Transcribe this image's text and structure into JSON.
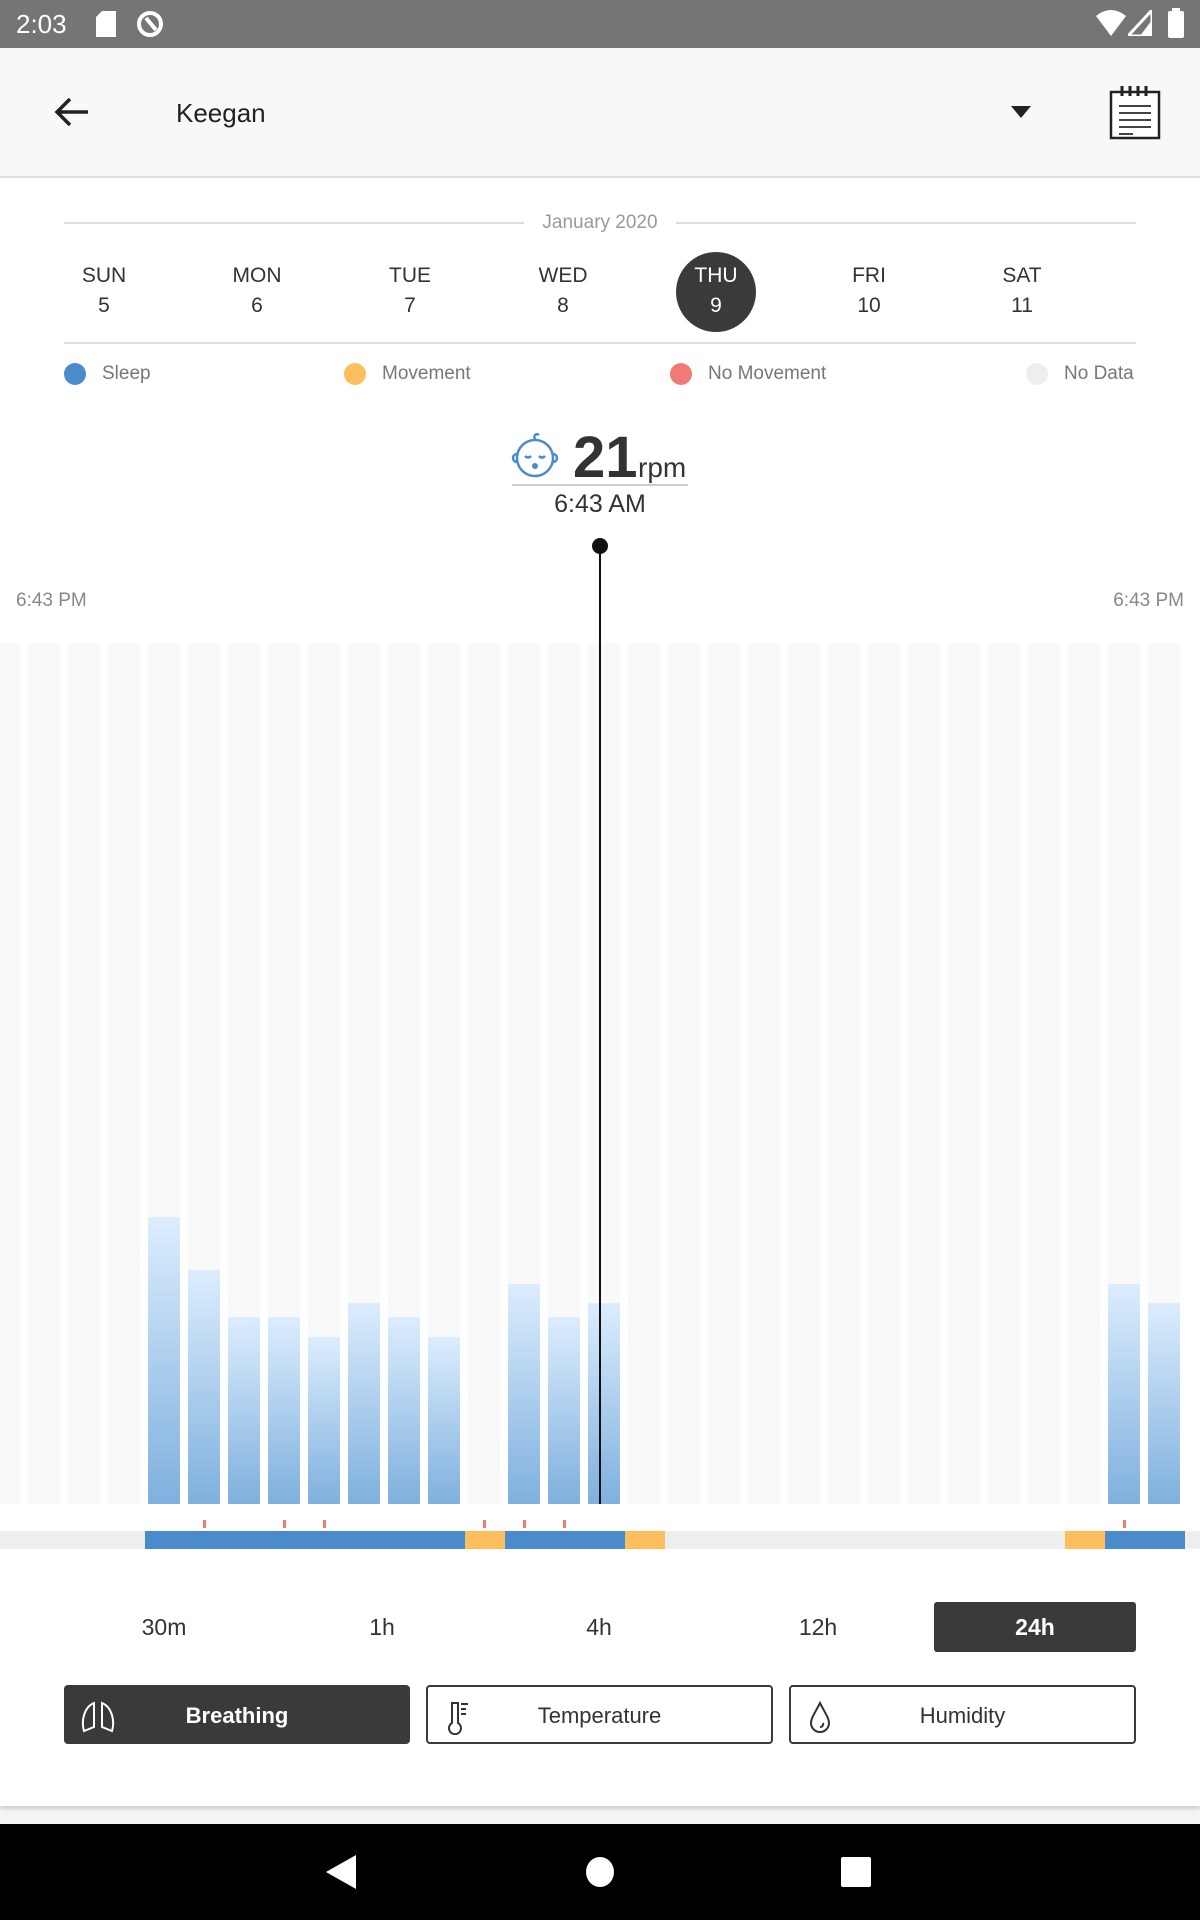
{
  "status_bar": {
    "time": "2:03",
    "icons": [
      "sd-card-icon",
      "sync-icon",
      "wifi-icon",
      "signal-icon",
      "battery-icon"
    ]
  },
  "header": {
    "title": "Keegan",
    "back_icon": "arrow-left-icon",
    "dropdown_icon": "caret-down-icon",
    "notes_icon": "notepad-icon"
  },
  "calendar": {
    "month": "January 2020",
    "selected": 4,
    "days": [
      {
        "name": "SUN",
        "num": "5"
      },
      {
        "name": "MON",
        "num": "6"
      },
      {
        "name": "TUE",
        "num": "7"
      },
      {
        "name": "WED",
        "num": "8"
      },
      {
        "name": "THU",
        "num": "9"
      },
      {
        "name": "FRI",
        "num": "10"
      },
      {
        "name": "SAT",
        "num": "11"
      }
    ]
  },
  "legend": [
    {
      "label": "Sleep",
      "color": "#4a8ccb"
    },
    {
      "label": "Movement",
      "color": "#fdbf5e"
    },
    {
      "label": "No Movement",
      "color": "#f07b74"
    },
    {
      "label": "No Data",
      "color": "#eeeeee"
    }
  ],
  "reading": {
    "value": "21",
    "unit": "rpm",
    "time": "6:43 AM",
    "icon": "sleeping-baby-icon"
  },
  "chart_data": {
    "type": "bar",
    "x_start_label": "6:43 PM",
    "x_end_label": "6:43 PM",
    "ylim": [
      0,
      90
    ],
    "values": [
      null,
      null,
      null,
      null,
      30,
      24.5,
      19.5,
      19.5,
      17.5,
      21,
      19.5,
      17.5,
      null,
      23,
      19.5,
      21,
      null,
      null,
      null,
      null,
      null,
      null,
      null,
      null,
      null,
      null,
      null,
      null,
      23,
      21
    ],
    "selected_index": 15,
    "state_strip": [
      "none",
      "none",
      "none",
      "none",
      "sleep",
      "sleep",
      "sleep",
      "sleep",
      "sleep",
      "sleep",
      "sleep",
      "sleep",
      "movement",
      "sleep",
      "sleep",
      "sleep",
      "movement",
      "none",
      "none",
      "none",
      "none",
      "none",
      "none",
      "none",
      "none",
      "none",
      "none",
      "movement",
      "sleep",
      "sleep"
    ],
    "no_movement_markers": [
      5,
      7,
      8,
      12,
      13,
      14,
      28
    ]
  },
  "ranges": {
    "items": [
      "30m",
      "1h",
      "4h",
      "12h",
      "24h"
    ],
    "selected": "24h"
  },
  "metrics": [
    {
      "label": "Breathing",
      "icon": "lungs-icon",
      "active": true
    },
    {
      "label": "Temperature",
      "icon": "thermometer-icon",
      "active": false
    },
    {
      "label": "Humidity",
      "icon": "droplet-icon",
      "active": false
    }
  ]
}
